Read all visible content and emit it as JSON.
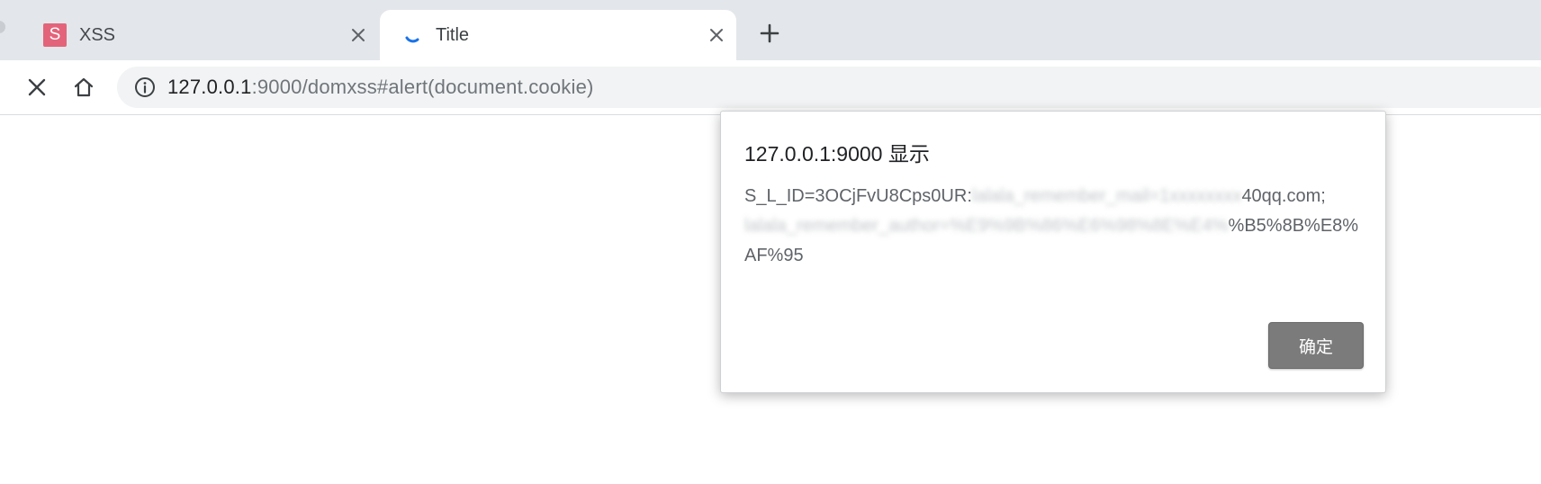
{
  "tabs": [
    {
      "title": "XSS",
      "favicon_letter": "S",
      "favicon_color": "#e3647a",
      "active": false
    },
    {
      "title": "Title",
      "icon": "loading-spinner-icon",
      "active": true
    }
  ],
  "toolbar": {
    "stop_icon": "close-icon",
    "home_icon": "home-icon"
  },
  "omnibox": {
    "url_host": "127.0.0.1",
    "url_rest": ":9000/domxss#alert(document.cookie)",
    "info_icon": "info-icon"
  },
  "dialog": {
    "title": "127.0.0.1:9000 显示",
    "message_part1": "S_L_ID=3OCjFvU8Cps0UR:",
    "message_part2": "40qq.com;",
    "message_part3": "%B5%8B%E8%AF%95",
    "ok_label": "确定"
  },
  "colors": {
    "tabstrip_bg": "#e3e6ea",
    "omnibox_bg": "#f1f3f4",
    "ok_button_bg": "#7b7b7b"
  }
}
